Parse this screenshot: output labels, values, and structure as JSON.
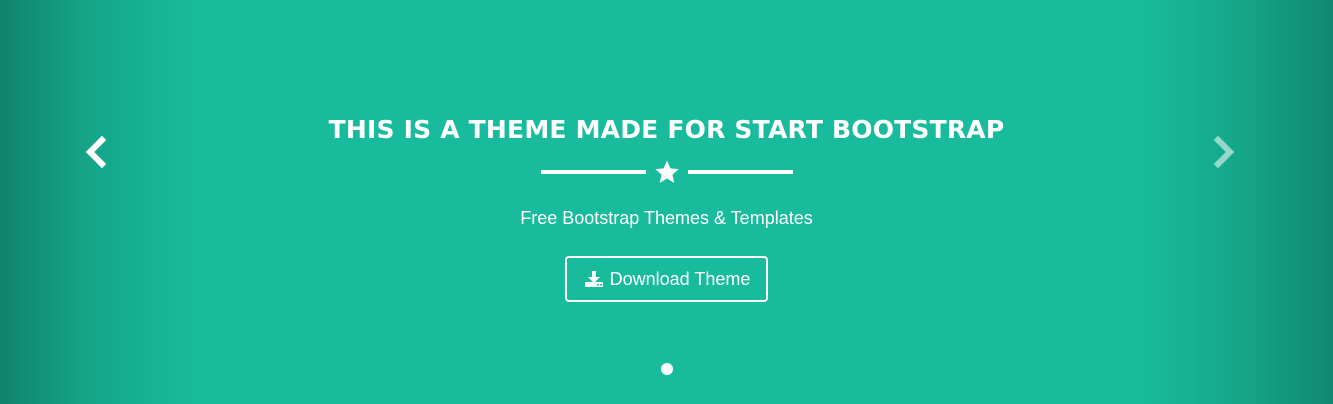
{
  "slide": {
    "headline": "THIS IS A THEME MADE FOR START BOOTSTRAP",
    "subtitle": "Free Bootstrap Themes & Templates",
    "button_label": "Download Theme",
    "divider_icon": "star-icon",
    "button_icon": "download-icon"
  },
  "controls": {
    "prev_icon": "chevron-left-icon",
    "next_icon": "chevron-right-icon"
  },
  "indicators": {
    "count": 1,
    "active_index": 0
  },
  "colors": {
    "background": "#18bc9c",
    "text": "#ffffff"
  }
}
